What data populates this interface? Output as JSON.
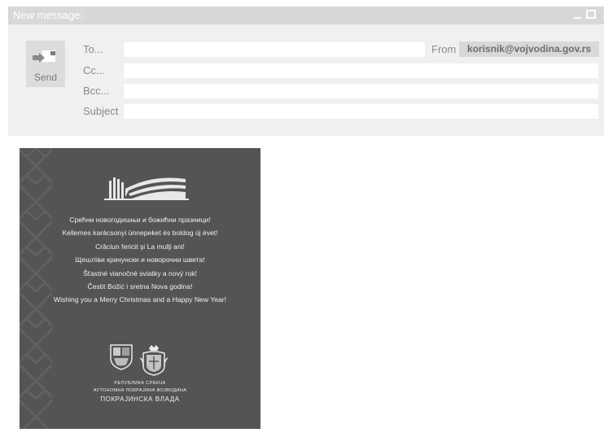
{
  "window": {
    "title": "New message:",
    "controls": [
      "minimize-icon",
      "maximize-icon",
      "close-icon"
    ]
  },
  "compose": {
    "send_label": "Send",
    "fields": {
      "to": {
        "label": "To...",
        "value": ""
      },
      "cc": {
        "label": "Cc...",
        "value": ""
      },
      "bcc": {
        "label": "Bcc...",
        "value": ""
      },
      "subject": {
        "label": "Subject",
        "value": ""
      }
    },
    "from": {
      "label": "From",
      "value": "korisnik@vojvodina.gov.rs"
    }
  },
  "card": {
    "greetings": [
      "Срећни новогодишњи и божићни празници!",
      "Kellemes karácsonyi ünnepeket és boldog új évet!",
      "Crăciun fericit şi La mulţi ani!",
      "Щешлїви крачунски и новорочни швета!",
      "Šťastné vianočné sviatky a nový rok!",
      "Čestit Božić i sretna Nova godina!",
      "Wishing you a Merry Christmas and a Happy New Year!"
    ],
    "org_line1": "РЕПУБЛИКА СРБИЈА",
    "org_line2": "АУТОНОМНА ПОКРАЈИНА ВОЈВОДИНА",
    "org_line3": "ПОКРАЈИНСКА ВЛАДА"
  },
  "colors": {
    "titlebar": "#d8d8d8",
    "header_bg": "#eff0f0",
    "card_bg": "#545454"
  }
}
